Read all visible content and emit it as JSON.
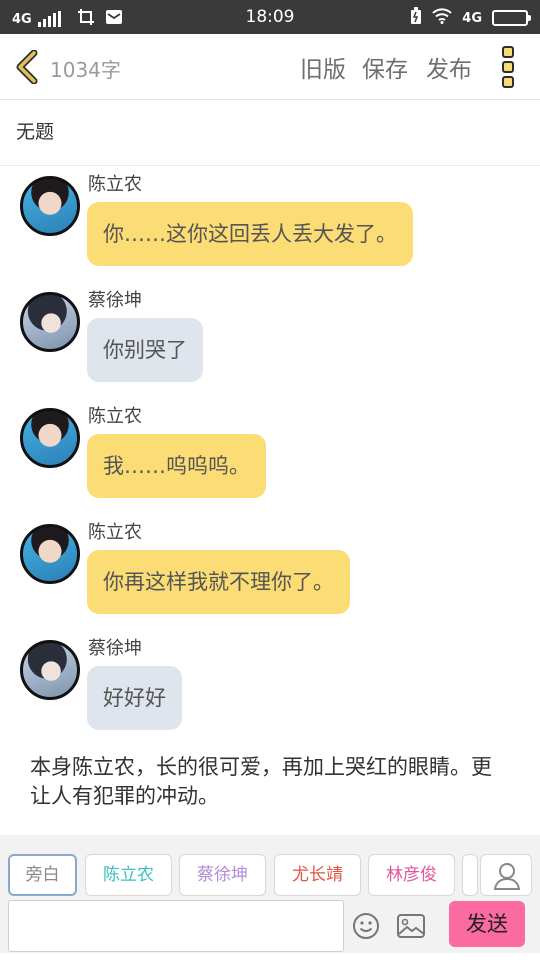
{
  "status_bar": {
    "network_left": "4G",
    "time": "18:09",
    "network_right": "4G"
  },
  "toolbar": {
    "word_count": "1034字",
    "old_version_label": "旧版",
    "save_label": "保存",
    "publish_label": "发布"
  },
  "document": {
    "title": "无题"
  },
  "messages": [
    {
      "sender": "陈立农",
      "text": "你……这你这回丢人丢大发了。",
      "style": "yellow"
    },
    {
      "sender": "蔡徐坤",
      "text": "你别哭了",
      "style": "gray"
    },
    {
      "sender": "陈立农",
      "text": "我……呜呜呜。",
      "style": "yellow"
    },
    {
      "sender": "陈立农",
      "text": "你再这样我就不理你了。",
      "style": "yellow"
    },
    {
      "sender": "蔡徐坤",
      "text": "好好好",
      "style": "gray"
    }
  ],
  "narration": "本身陈立农，长的很可爱，再加上哭红的眼睛。更让人有犯罪的冲动。",
  "roles": [
    {
      "label": "旁白",
      "color": "#888888",
      "selected": true
    },
    {
      "label": "陈立农",
      "color": "#3bbfbf",
      "selected": false
    },
    {
      "label": "蔡徐坤",
      "color": "#b58ad9",
      "selected": false
    },
    {
      "label": "尤长靖",
      "color": "#e2553e",
      "selected": false
    },
    {
      "label": "林彦俊",
      "color": "#e2569a",
      "selected": false
    }
  ],
  "composer": {
    "input_value": "",
    "send_label": "发送"
  },
  "colors": {
    "accent_yellow": "#fcdc74",
    "bubble_gray": "#dee5ec",
    "send_pink": "#fb6aa0",
    "back_chevron": "#d9b540"
  }
}
